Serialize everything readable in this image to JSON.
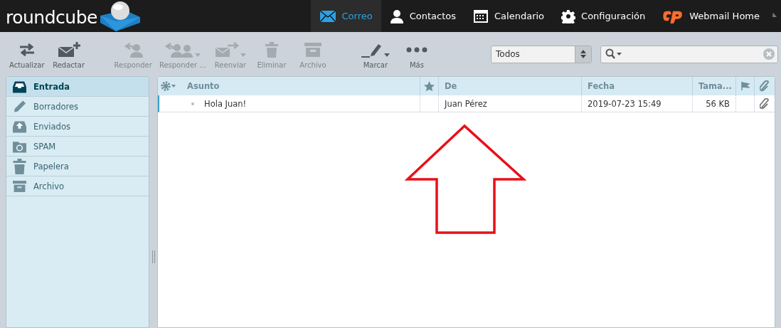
{
  "logo": {
    "text": "roundcube"
  },
  "nav": [
    {
      "label": "Correo",
      "kind": "mail",
      "selected": true
    },
    {
      "label": "Contactos",
      "kind": "person",
      "selected": false
    },
    {
      "label": "Calendario",
      "kind": "calendar",
      "selected": false
    },
    {
      "label": "Configuración",
      "kind": "gear",
      "selected": false
    },
    {
      "label": "Webmail Home",
      "kind": "cpanel",
      "selected": false
    }
  ],
  "toolbar": [
    {
      "label": "Actualizar",
      "kind": "refresh",
      "disabled": false,
      "has_menu": false
    },
    {
      "label": "Redactar",
      "kind": "compose",
      "disabled": false,
      "has_menu": false
    },
    {
      "label": "Responder",
      "kind": "reply",
      "disabled": true,
      "has_menu": false
    },
    {
      "label": "Responder ...",
      "kind": "replyall",
      "disabled": true,
      "has_menu": true
    },
    {
      "label": "Reenviar",
      "kind": "forward",
      "disabled": true,
      "has_menu": true
    },
    {
      "label": "Eliminar",
      "kind": "trash",
      "disabled": true,
      "has_menu": false
    },
    {
      "label": "Archivo",
      "kind": "archive",
      "disabled": true,
      "has_menu": false
    },
    {
      "label": "Marcar",
      "kind": "pen",
      "disabled": false,
      "has_menu": true
    },
    {
      "label": "Más",
      "kind": "dots",
      "disabled": false,
      "has_menu": false
    }
  ],
  "filter": {
    "value": "Todos"
  },
  "folders": [
    {
      "label": "Entrada",
      "kind": "inbox",
      "selected": true
    },
    {
      "label": "Borradores",
      "kind": "pencil",
      "selected": false
    },
    {
      "label": "Enviados",
      "kind": "sent",
      "selected": false
    },
    {
      "label": "SPAM",
      "kind": "spam",
      "selected": false
    },
    {
      "label": "Papelera",
      "kind": "trash",
      "selected": false
    },
    {
      "label": "Archivo",
      "kind": "archive",
      "selected": false
    }
  ],
  "columns": {
    "subject": "Asunto",
    "from": "De",
    "date": "Fecha",
    "size": "Tama..."
  },
  "messages": [
    {
      "subject": "Hola Juan!",
      "from": "Juan Pérez",
      "date": "2019-07-23 15:49",
      "size": "56 KB",
      "attachment": true,
      "focused": true
    }
  ],
  "annotation": {
    "kind": "up-arrow"
  }
}
